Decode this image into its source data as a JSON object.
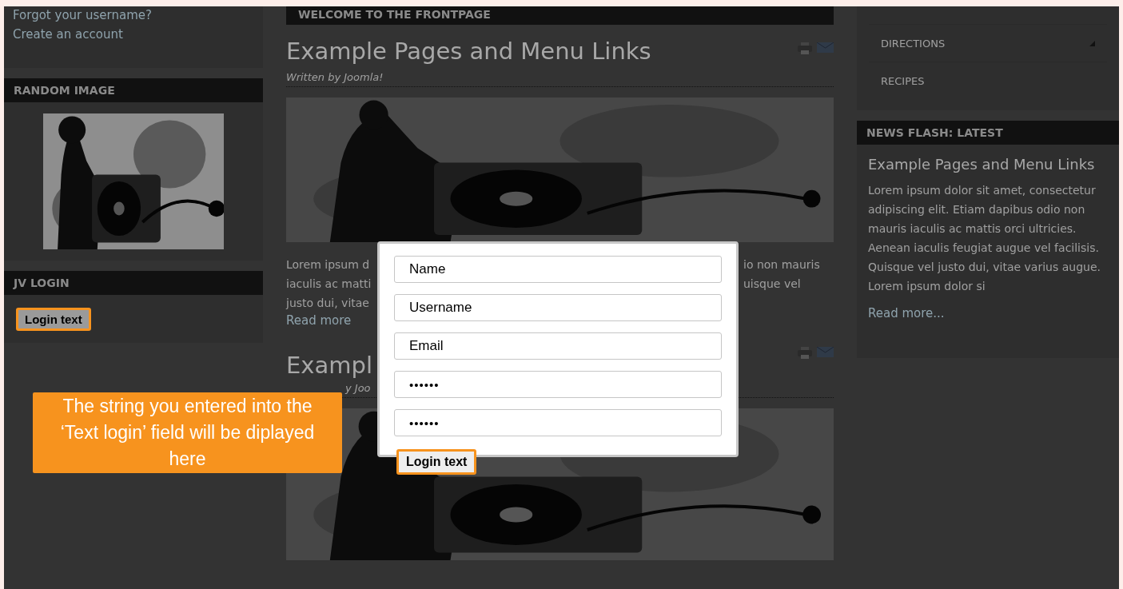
{
  "left": {
    "links": [
      "Forgot your username?",
      "Create an account"
    ],
    "random_image": {
      "title": "RANDOM IMAGE"
    },
    "login_module": {
      "title": "JV LOGIN",
      "button": {
        "label": "Login text",
        "highlighted": true
      }
    }
  },
  "main": {
    "header": "WELCOME TO THE FRONTPAGE",
    "articles": [
      {
        "title": "Example Pages and Menu Links",
        "author": "Written by Joomla!",
        "paragraph_lines": [
          {
            "left": "Lorem ipsum d",
            "right": "io non mauris"
          },
          {
            "left": "iaculis ac matti",
            "right": "uisque vel"
          },
          {
            "left": "justo dui, vitae"
          }
        ],
        "read_more": "Read more"
      },
      {
        "title": "Exampl",
        "author": "y Joo"
      }
    ]
  },
  "right": {
    "menu": [
      {
        "label": "DIRECTIONS",
        "expandable": true
      },
      {
        "label": "RECIPES",
        "expandable": false
      }
    ],
    "news_flash": {
      "title": "NEWS FLASH: LATEST",
      "headline": "Example Pages and Menu Links",
      "text": "Lorem ipsum dolor sit amet, consectetur adipiscing elit. Etiam dapibus odio non mauris iaculis ac mattis orci ultricies. Aenean iaculis feugiat augue vel facilisis. Quisque vel justo dui, vitae varius augue. Lorem ipsum dolor si",
      "read_more": "Read more..."
    }
  },
  "modal": {
    "fields": [
      {
        "kind": "text",
        "value": "Name"
      },
      {
        "kind": "text",
        "value": "Username"
      },
      {
        "kind": "text",
        "value": "Email"
      },
      {
        "kind": "password",
        "value": "••••••"
      },
      {
        "kind": "password",
        "value": "••••••"
      }
    ],
    "button": {
      "label": "Login text",
      "highlighted": true
    }
  },
  "callout": "The string you entered into the ‘Text login’ field will be diplayed here"
}
